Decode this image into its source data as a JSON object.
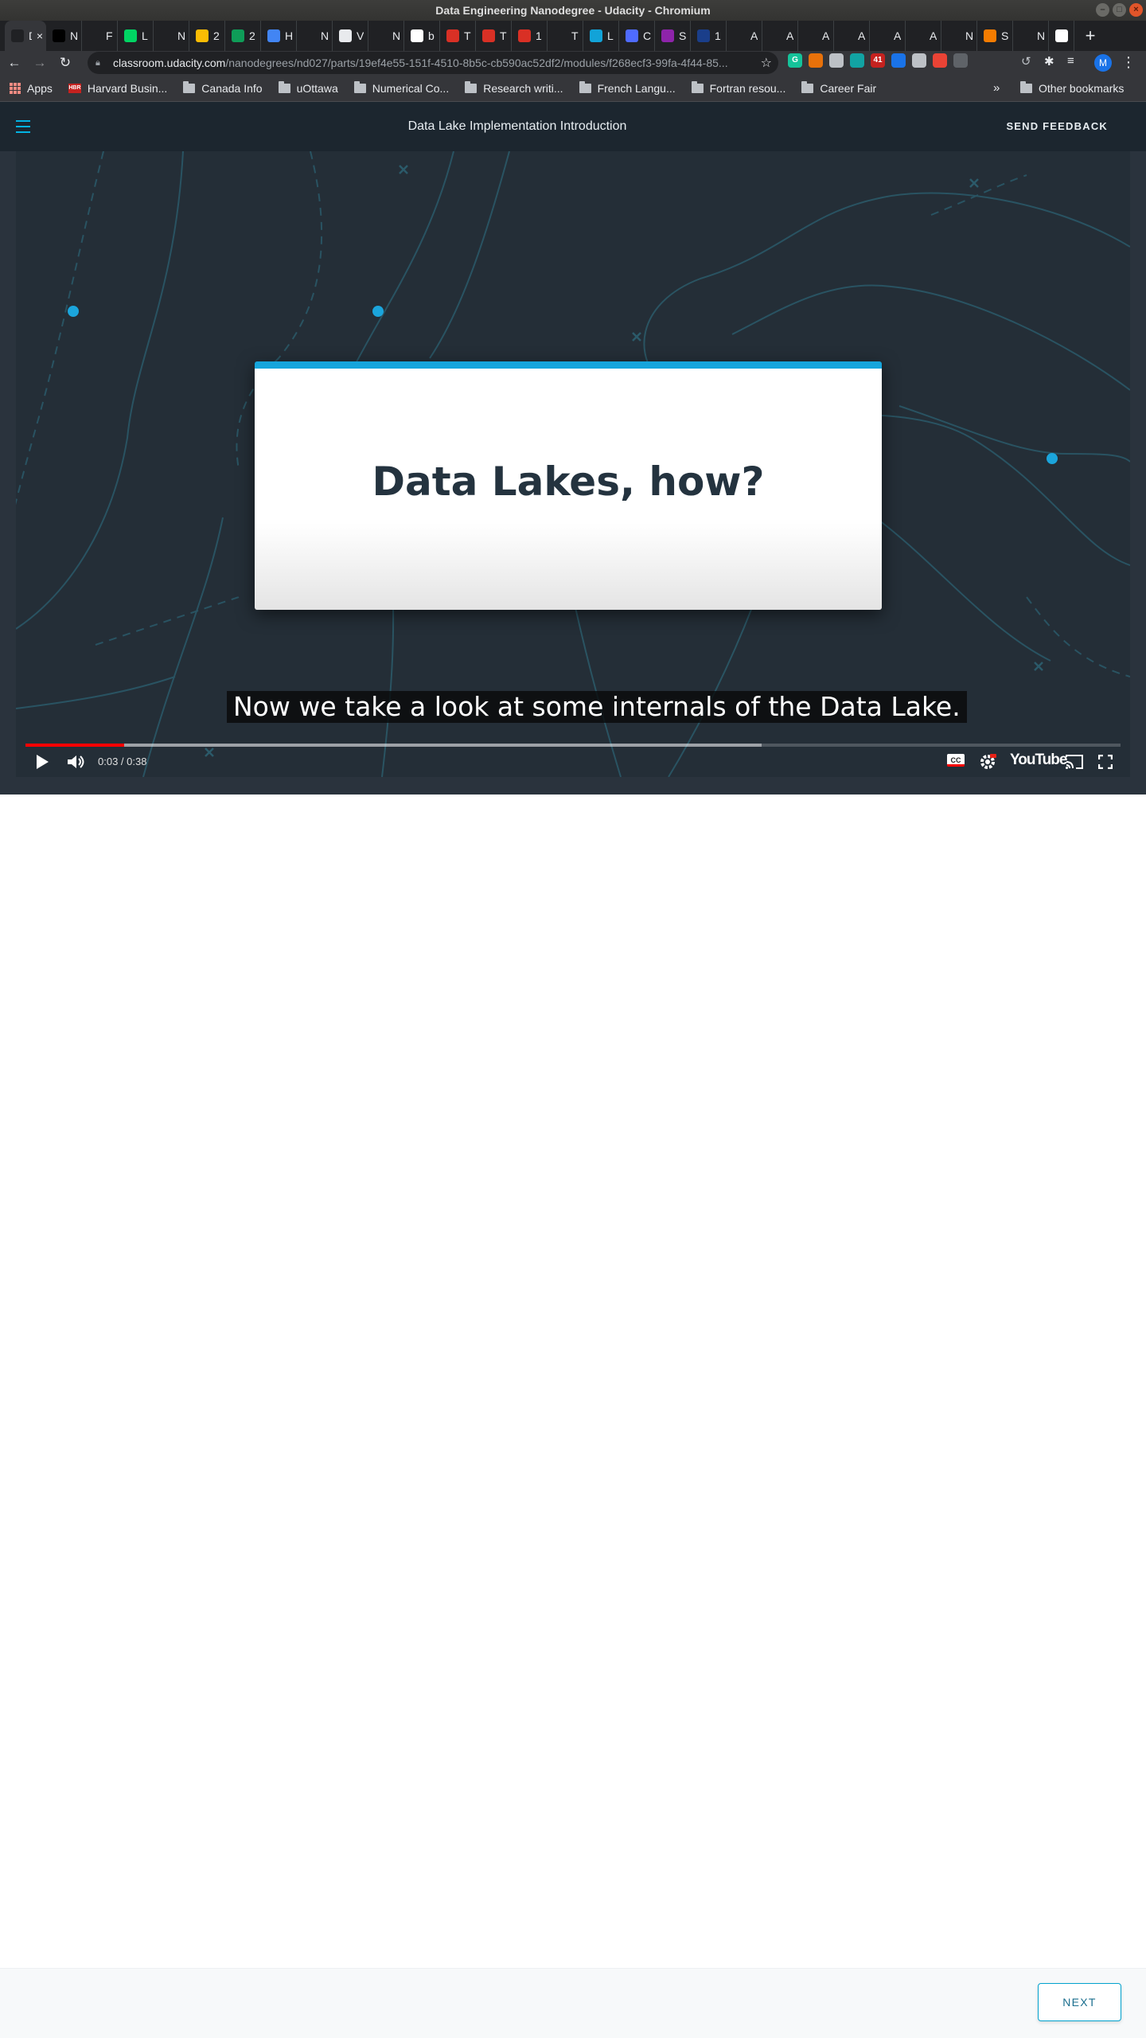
{
  "window": {
    "title": "Data Engineering Nanodegree - Udacity - Chromium"
  },
  "tabs": [
    {
      "label": "D",
      "active": true,
      "favicon_color": "#202124"
    },
    {
      "label": "N",
      "favicon_color": "#000000"
    },
    {
      "label": "F",
      "favicon_color": "#202124"
    },
    {
      "label": "L",
      "favicon_color": "#00d563"
    },
    {
      "label": "New",
      "favicon_color": "#202124"
    },
    {
      "label": "2",
      "favicon_color": "#fbbc04"
    },
    {
      "label": "2",
      "favicon_color": "#0f9d58"
    },
    {
      "label": "H",
      "favicon_color": "#4285f4"
    },
    {
      "label": "New",
      "favicon_color": "#202124"
    },
    {
      "label": "V",
      "favicon_color": "#e8eaed"
    },
    {
      "label": "New",
      "favicon_color": "#202124"
    },
    {
      "label": "b",
      "favicon_color": "#ffffff"
    },
    {
      "label": "T",
      "favicon_color": "#d93025"
    },
    {
      "label": "T",
      "favicon_color": "#d93025"
    },
    {
      "label": "1",
      "favicon_color": "#d93025"
    },
    {
      "label": "T",
      "favicon_color": "#202124"
    },
    {
      "label": "L",
      "favicon_color": "#12a3d8"
    },
    {
      "label": "C",
      "favicon_color": "#4f6bff"
    },
    {
      "label": "S",
      "favicon_color": "#8e24aa"
    },
    {
      "label": "1",
      "favicon_color": "#1a3e8a"
    },
    {
      "label": "A",
      "favicon_color": "#202124"
    },
    {
      "label": "A",
      "favicon_color": "#202124"
    },
    {
      "label": "A",
      "favicon_color": "#202124"
    },
    {
      "label": "A",
      "favicon_color": "#202124"
    },
    {
      "label": "A",
      "favicon_color": "#202124"
    },
    {
      "label": "A",
      "favicon_color": "#202124"
    },
    {
      "label": "New",
      "favicon_color": "#202124"
    },
    {
      "label": "S",
      "favicon_color": "#f57c00"
    },
    {
      "label": "New",
      "favicon_color": "#202124"
    },
    {
      "label": "c",
      "favicon_color": "#ffffff"
    }
  ],
  "address_bar": {
    "host": "classroom.udacity.com",
    "path": "/nanodegrees/nd027/parts/19ef4e55-151f-4510-8b5c-cb590ac52df2/modules/f268ecf3-99fa-4f44-85..."
  },
  "profile_initial": "M",
  "extensions": [
    {
      "name": "grammarly-icon",
      "color": "#15c39a",
      "text": "G"
    },
    {
      "name": "extension-orange-icon",
      "color": "#e8710a",
      "text": ""
    },
    {
      "name": "docs-icon",
      "color": "#bdc1c6",
      "text": ""
    },
    {
      "name": "extension-teal-icon",
      "color": "#12a3a3",
      "text": ""
    },
    {
      "name": "extension-badge-icon",
      "color": "#c5221f",
      "text": "41"
    },
    {
      "name": "extension-blue-icon",
      "color": "#1a73e8",
      "text": ""
    },
    {
      "name": "cloud-icon",
      "color": "#bdc1c6",
      "text": ""
    },
    {
      "name": "extension-red-icon",
      "color": "#ea4335",
      "text": ""
    },
    {
      "name": "extension-gray-icon",
      "color": "#5f6368",
      "text": ""
    }
  ],
  "bookmarks": {
    "apps": "Apps",
    "items": [
      {
        "label": "Harvard Busin...",
        "kind": "hbr"
      },
      {
        "label": "Canada Info",
        "kind": "folder"
      },
      {
        "label": "uOttawa",
        "kind": "folder"
      },
      {
        "label": "Numerical Co...",
        "kind": "folder"
      },
      {
        "label": "Research writi...",
        "kind": "folder"
      },
      {
        "label": "French Langu...",
        "kind": "folder"
      },
      {
        "label": "Fortran resou...",
        "kind": "folder"
      },
      {
        "label": "Career Fair",
        "kind": "folder"
      }
    ],
    "more": "»",
    "other": "Other bookmarks"
  },
  "header": {
    "title": "Data Lake Implementation Introduction",
    "feedback": "SEND FEEDBACK"
  },
  "video": {
    "slide_title": "Data Lakes, how?",
    "caption": "Now we take a look at some internals of the Data Lake.",
    "time": "0:03 / 0:38",
    "played_fraction": 0.09,
    "buffered_fraction": 0.672,
    "cc_label": "CC",
    "logo": "YouTube",
    "accent_color": "#16a5dc"
  },
  "footer": {
    "next_label": "NEXT"
  },
  "colors": {
    "header_bg": "#1c262f",
    "brand": "#02b3e4",
    "progress": "#ff0000"
  }
}
